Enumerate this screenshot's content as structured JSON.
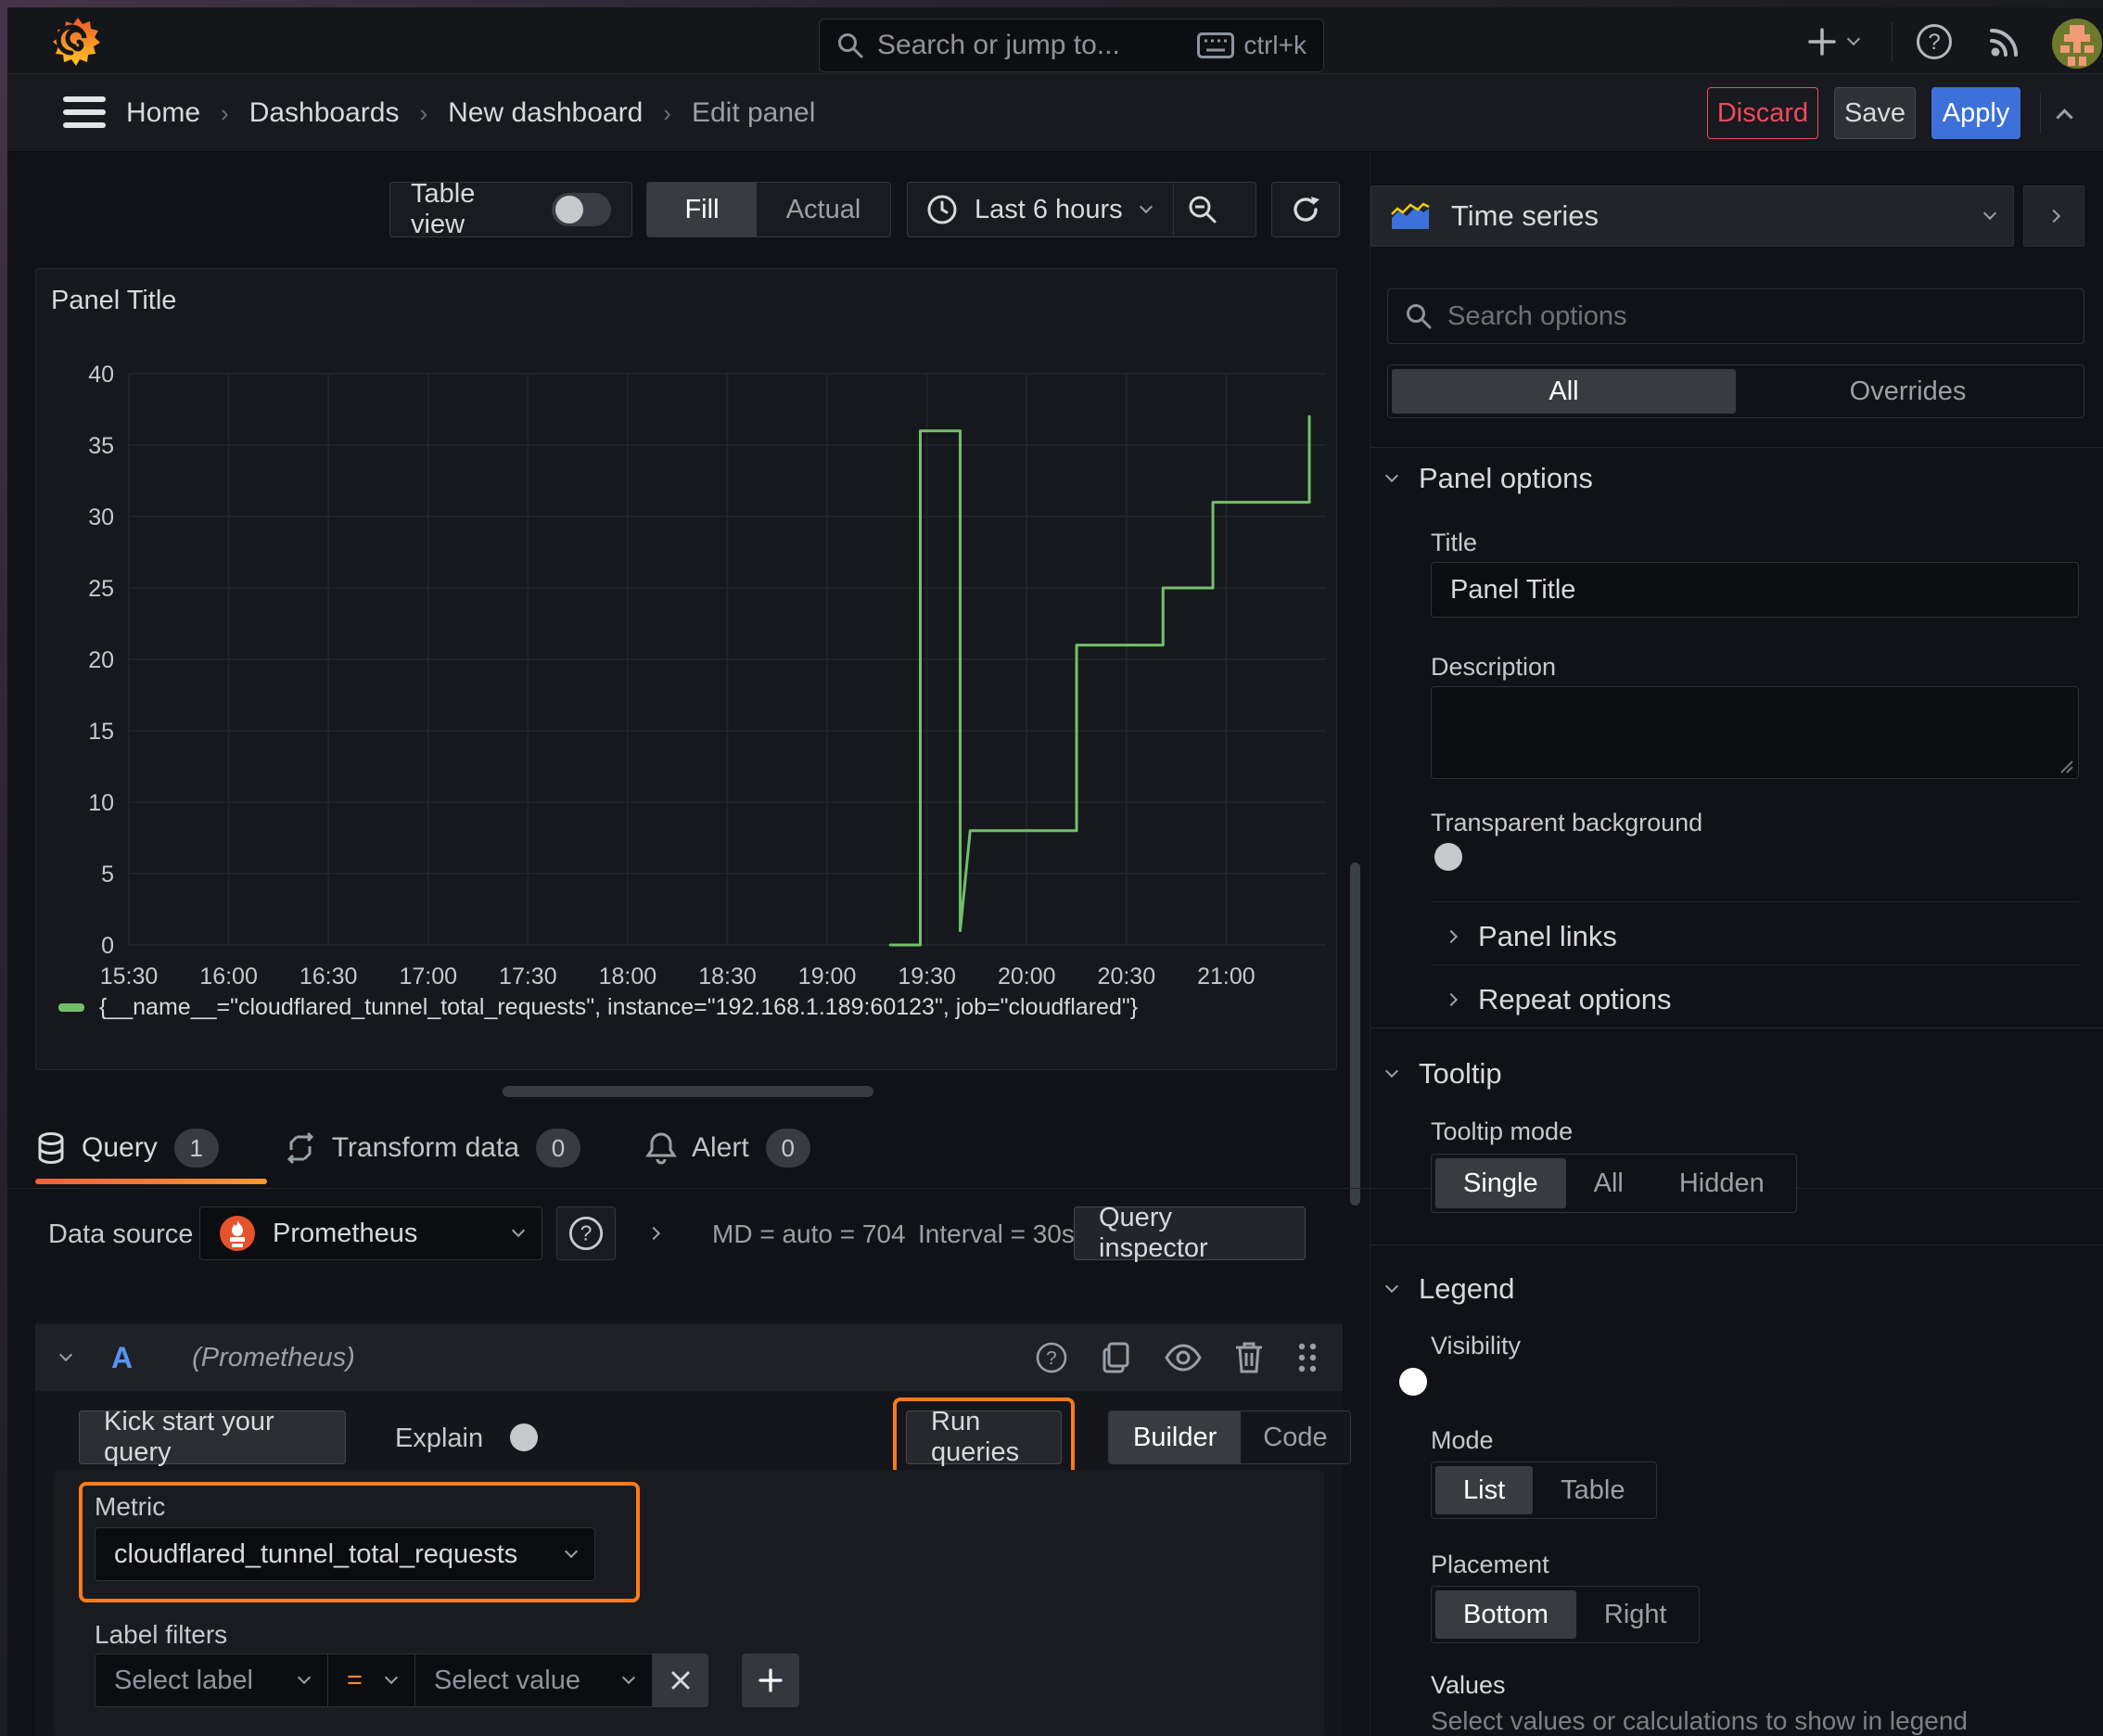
{
  "topnav": {
    "search_placeholder": "Search or jump to...",
    "shortcut": "ctrl+k"
  },
  "breadcrumb": {
    "items": [
      {
        "label": "Home"
      },
      {
        "label": "Dashboards"
      },
      {
        "label": "New dashboard"
      },
      {
        "label": "Edit panel"
      }
    ],
    "discard": "Discard",
    "save": "Save",
    "apply": "Apply"
  },
  "toolbar": {
    "table_view_label": "Table view",
    "fill_label": "Fill",
    "actual_label": "Actual",
    "time_range": "Last 6 hours"
  },
  "chart_data": {
    "type": "line",
    "title": "Panel Title",
    "x_ticks": [
      "15:30",
      "16:00",
      "16:30",
      "17:00",
      "17:30",
      "18:00",
      "18:30",
      "19:00",
      "19:30",
      "20:00",
      "20:30",
      "21:00"
    ],
    "x_tick_minutes": [
      0,
      30,
      60,
      90,
      120,
      150,
      180,
      210,
      240,
      270,
      300,
      330
    ],
    "x_domain_minutes": [
      0,
      360
    ],
    "ylim": [
      0,
      40
    ],
    "y_ticks": [
      0,
      5,
      10,
      15,
      20,
      25,
      30,
      35,
      40
    ],
    "grid": true,
    "line_color": "#73bf69",
    "legend_position": "bottom",
    "series": [
      {
        "name": "{__name__=\"cloudflared_tunnel_total_requests\", instance=\"192.168.1.189:60123\", job=\"cloudflared\"}",
        "points_min_value": [
          [
            229,
            0
          ],
          [
            238,
            0
          ],
          [
            238,
            36
          ],
          [
            250,
            36
          ],
          [
            250,
            1
          ],
          [
            253,
            8
          ],
          [
            285,
            8
          ],
          [
            285,
            21
          ],
          [
            311,
            21
          ],
          [
            311,
            25
          ],
          [
            326,
            25
          ],
          [
            326,
            31
          ],
          [
            355,
            31
          ],
          [
            355,
            37
          ]
        ]
      }
    ]
  },
  "tabs": {
    "query": {
      "label": "Query",
      "count": "1"
    },
    "transform": {
      "label": "Transform data",
      "count": "0"
    },
    "alert": {
      "label": "Alert",
      "count": "0"
    }
  },
  "datasource": {
    "label": "Data source",
    "name": "Prometheus",
    "max_data_points": "MD = auto = 704",
    "interval": "Interval = 30s",
    "inspector": "Query inspector"
  },
  "query_editor": {
    "ref_id": "A",
    "ds_hint": "(Prometheus)",
    "kick_start": "Kick start your query",
    "explain": "Explain",
    "run_queries": "Run queries",
    "builder": "Builder",
    "code": "Code"
  },
  "metric": {
    "label": "Metric",
    "value": "cloudflared_tunnel_total_requests"
  },
  "filters": {
    "label": "Label filters",
    "select_label": "Select label",
    "operator": "=",
    "select_value": "Select value"
  },
  "sidebar": {
    "viz_label": "Time series",
    "search_placeholder": "Search options",
    "tab_all": "All",
    "tab_overrides": "Overrides",
    "panel_options": {
      "header": "Panel options",
      "title_label": "Title",
      "title_value": "Panel Title",
      "description_label": "Description",
      "transparent_label": "Transparent background"
    },
    "panel_links": "Panel links",
    "repeat_options": "Repeat options",
    "tooltip": {
      "header": "Tooltip",
      "mode_label": "Tooltip mode",
      "opt_single": "Single",
      "opt_all": "All",
      "opt_hidden": "Hidden"
    },
    "legend": {
      "header": "Legend",
      "visibility_label": "Visibility",
      "mode_label": "Mode",
      "mode_list": "List",
      "mode_table": "Table",
      "placement_label": "Placement",
      "placement_bottom": "Bottom",
      "placement_right": "Right",
      "values_label": "Values",
      "values_help": "Select values or calculations to show in legend"
    }
  },
  "colors": {
    "accent_orange": "#ff7a1a",
    "series_green": "#73bf69",
    "primary_blue": "#3d71d9",
    "danger_red": "#f2495c"
  },
  "icons": {
    "grafana-logo": "orange flame spiral",
    "menu-icon": "hamburger",
    "search-icon": "magnifier",
    "keyboard-icon": "keyboard",
    "plus-icon": "+",
    "chevron-down-icon": "chevron down",
    "chevron-right-icon": "chevron right",
    "chevron-up-icon": "chevron up",
    "help-icon": "? in circle",
    "news-icon": "broadcast arcs",
    "avatar": "pixel avatar",
    "clock-icon": "clock face",
    "zoom-out-icon": "magnifier with minus",
    "refresh-icon": "circular arrow",
    "database-icon": "db cylinder",
    "transform-icon": "cycle arrows",
    "bell-icon": "bell",
    "prometheus-icon": "orange torch",
    "copy-icon": "two pages",
    "eye-icon": "eye",
    "trash-icon": "trash can",
    "drag-icon": "six dots grip",
    "remove-icon": "x cross",
    "timeseries-icon": "mini area chart",
    "resize-icon": "corner grip"
  }
}
